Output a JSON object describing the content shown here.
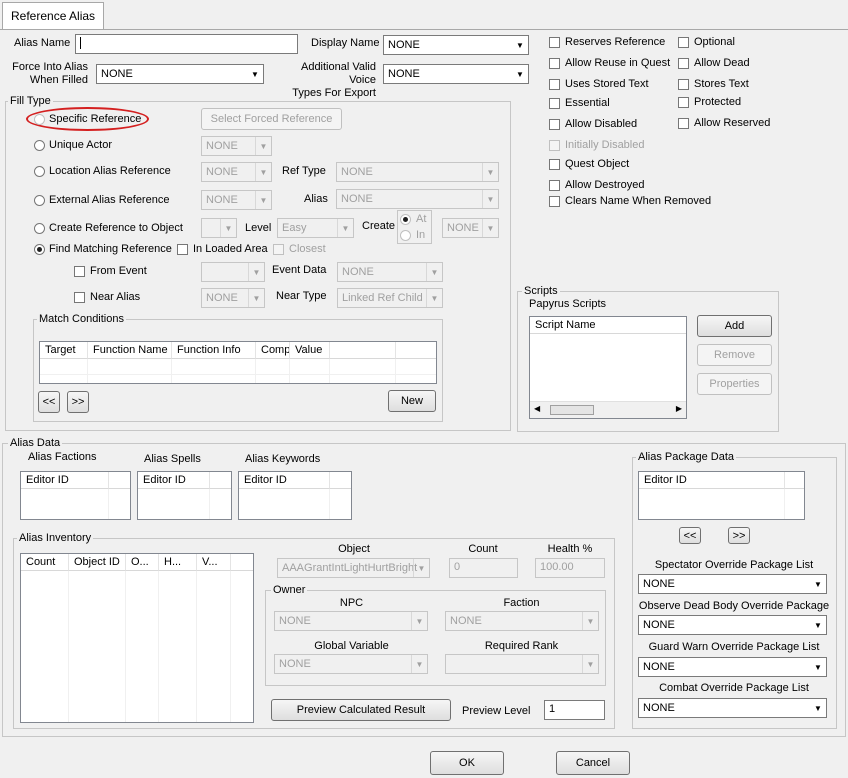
{
  "tab": {
    "label": "Reference Alias"
  },
  "top": {
    "alias_name_label": "Alias Name",
    "alias_name_value": "",
    "display_name_label": "Display Name",
    "display_name_value": "NONE",
    "force_into_alias_label_1": "Force Into Alias",
    "force_into_alias_label_2": "When Filled",
    "force_into_alias_value": "NONE",
    "voice_types_label_1": "Additional Valid Voice",
    "voice_types_label_2": "Types For Export",
    "voice_types_value": "NONE"
  },
  "flags": {
    "reserves_reference": "Reserves Reference",
    "optional": "Optional",
    "allow_reuse": "Allow Reuse in Quest",
    "allow_dead": "Allow Dead",
    "uses_stored_text": "Uses Stored Text",
    "stores_text": "Stores Text",
    "essential": "Essential",
    "protected": "Protected",
    "allow_disabled": "Allow Disabled",
    "allow_reserved": "Allow Reserved",
    "initially_disabled": "Initially Disabled",
    "quest_object": "Quest Object",
    "allow_destroyed": "Allow Destroyed",
    "clears_name": "Clears Name When Removed"
  },
  "fill_type": {
    "title": "Fill Type",
    "specific_reference": "Specific Reference",
    "select_forced_reference": "Select Forced Reference",
    "unique_actor": "Unique Actor",
    "unique_actor_value": "NONE",
    "location_alias_reference": "Location Alias Reference",
    "location_alias_value": "NONE",
    "ref_type_label": "Ref Type",
    "ref_type_value": "NONE",
    "external_alias_reference": "External Alias Reference",
    "external_alias_value": "NONE",
    "alias_label": "Alias",
    "alias_value": "NONE",
    "create_reference": "Create Reference to Object",
    "level_label": "Level",
    "level_value": "Easy",
    "create_label": "Create",
    "create_at": "At",
    "create_in": "In",
    "create_value": "NONE",
    "find_matching": "Find Matching Reference",
    "in_loaded_area": "In Loaded Area",
    "closest": "Closest",
    "from_event": "From Event",
    "event_data_label": "Event Data",
    "event_data_value": "NONE",
    "near_alias": "Near Alias",
    "near_alias_value": "NONE",
    "near_type_label": "Near Type",
    "near_type_value": "Linked Ref Child",
    "match_conditions": {
      "title": "Match Conditions",
      "columns": [
        "Target",
        "Function Name",
        "Function Info",
        "Comp",
        "Value"
      ],
      "prev": "<<",
      "next": ">>",
      "new_button": "New"
    }
  },
  "scripts": {
    "title": "Scripts",
    "papyrus_label": "Papyrus Scripts",
    "column": "Script Name",
    "add": "Add",
    "remove": "Remove",
    "properties": "Properties"
  },
  "alias_data": {
    "title": "Alias Data",
    "factions_label": "Alias Factions",
    "factions_col": "Editor ID",
    "spells_label": "Alias Spells",
    "spells_col": "Editor ID",
    "keywords_label": "Alias Keywords",
    "keywords_col": "Editor ID",
    "inventory": {
      "title": "Alias Inventory",
      "columns": [
        "Count",
        "Object ID",
        "O...",
        "H...",
        "V..."
      ],
      "object_label": "Object",
      "object_value": "AAAGrantIntLightHurtBright",
      "count_label": "Count",
      "count_value": "0",
      "health_label": "Health %",
      "health_value": "100.00"
    },
    "owner": {
      "title": "Owner",
      "npc_label": "NPC",
      "npc_value": "NONE",
      "faction_label": "Faction",
      "faction_value": "NONE",
      "global_label": "Global Variable",
      "global_value": "NONE",
      "rank_label": "Required Rank",
      "rank_value": ""
    },
    "preview_button": "Preview Calculated Result",
    "preview_level_label": "Preview Level",
    "preview_level_value": "1"
  },
  "package_data": {
    "title": "Alias Package Data",
    "column": "Editor ID",
    "prev": "<<",
    "next": ">>",
    "spectator_label": "Spectator Override Package List",
    "spectator_value": "NONE",
    "observe_label": "Observe Dead Body Override Package",
    "observe_value": "NONE",
    "guard_label": "Guard Warn Override Package List",
    "guard_value": "NONE",
    "combat_label": "Combat Override Package List",
    "combat_value": "NONE"
  },
  "dialog": {
    "ok": "OK",
    "cancel": "Cancel"
  }
}
